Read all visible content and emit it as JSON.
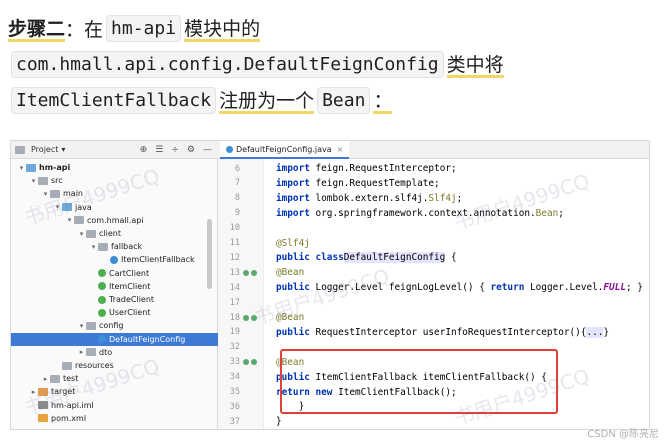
{
  "heading": {
    "line1": {
      "bold": "步骤二",
      "t1": "：在",
      "code1": "hm-api",
      "t2": "模块中的"
    },
    "line2": {
      "code1": "com.hmall.api.config.DefaultFeignConfig",
      "t1": "类中将"
    },
    "line3": {
      "code1": "ItemClientFallback",
      "t1": "注册为一个",
      "code2": "Bean",
      "t2": "："
    }
  },
  "ide": {
    "project_label": "Project",
    "toolbar_icons": [
      "⊕",
      "☰",
      "÷",
      "⚙",
      "—"
    ],
    "tab_label": "DefaultFeignConfig.java",
    "tree": [
      {
        "label": "hm-api",
        "level": 0,
        "arrow": "▾",
        "icon": "folder-blue",
        "bold": true
      },
      {
        "label": "src",
        "level": 1,
        "arrow": "▾",
        "icon": "folder"
      },
      {
        "label": "main",
        "level": 2,
        "arrow": "▾",
        "icon": "folder"
      },
      {
        "label": "java",
        "level": 3,
        "arrow": "▾",
        "icon": "folder-blue"
      },
      {
        "label": "com.hmall.api",
        "level": 4,
        "arrow": "▾",
        "icon": "folder"
      },
      {
        "label": "client",
        "level": 5,
        "arrow": "▾",
        "icon": "folder"
      },
      {
        "label": "fallback",
        "level": 6,
        "arrow": "▾",
        "icon": "folder"
      },
      {
        "label": "ItemClientFallback",
        "level": 7,
        "arrow": "",
        "icon": "cls"
      },
      {
        "label": "CartClient",
        "level": 6,
        "arrow": "",
        "icon": "cls intf"
      },
      {
        "label": "ItemClient",
        "level": 6,
        "arrow": "",
        "icon": "cls intf"
      },
      {
        "label": "TradeClient",
        "level": 6,
        "arrow": "",
        "icon": "cls intf"
      },
      {
        "label": "UserClient",
        "level": 6,
        "arrow": "",
        "icon": "cls intf"
      },
      {
        "label": "config",
        "level": 5,
        "arrow": "▾",
        "icon": "folder"
      },
      {
        "label": "DefaultFeignConfig",
        "level": 6,
        "arrow": "",
        "icon": "cls",
        "selected": true
      },
      {
        "label": "dto",
        "level": 5,
        "arrow": "▸",
        "icon": "folder"
      },
      {
        "label": "resources",
        "level": 3,
        "arrow": "",
        "icon": "folder"
      },
      {
        "label": "test",
        "level": 2,
        "arrow": "▸",
        "icon": "folder"
      },
      {
        "label": "target",
        "level": 1,
        "arrow": "▸",
        "icon": "folder-orange"
      },
      {
        "label": "hm-api.iml",
        "level": 1,
        "arrow": "",
        "icon": "file-iml"
      },
      {
        "label": "pom.xml",
        "level": 1,
        "arrow": "",
        "icon": "file-xml"
      }
    ],
    "code_lines": [
      {
        "n": "6",
        "html": "<span class='kw'>import</span> feign.RequestInterceptor;"
      },
      {
        "n": "7",
        "html": "<span class='kw'>import</span> feign.RequestTemplate;"
      },
      {
        "n": "8",
        "html": "<span class='kw'>import</span> lombok.extern.slf4j.<span class='ann'>Slf4j</span>;"
      },
      {
        "n": "9",
        "html": "<span class='kw'>import</span> org.springframework.context.annotation.<span class='ann'>Bean</span>;"
      },
      {
        "n": "10",
        "html": ""
      },
      {
        "n": "11",
        "html": "<span class='ann'>@Slf4j</span>"
      },
      {
        "n": "12",
        "html": "<span class='kw'>public class</span> <span class='hl-cls'>DefaultFeignConfig</span> {"
      },
      {
        "n": "13",
        "html": "    <span class='ann'>@Bean</span>",
        "mark": true
      },
      {
        "n": "14",
        "html": "    <span class='kw'>public</span> Logger.Level feignLogLevel() { <span class='kw'>return</span> Logger.Level.<span class='fld'>FULL</span>; }"
      },
      {
        "n": "17",
        "html": ""
      },
      {
        "n": "18",
        "html": "    <span class='ann'>@Bean</span>",
        "mark": true
      },
      {
        "n": "19",
        "html": "    <span class='kw'>public</span> RequestInterceptor userInfoRequestInterceptor(){<span class='fold'>...</span>}"
      },
      {
        "n": "32",
        "html": ""
      },
      {
        "n": "33",
        "html": "    <span class='ann'>@Bean</span>",
        "mark": true
      },
      {
        "n": "34",
        "html": "    <span class='kw'>public</span> ItemClientFallback itemClientFallback() {"
      },
      {
        "n": "35",
        "html": "        <span class='kw'>return new</span> ItemClientFallback();"
      },
      {
        "n": "36",
        "html": "    }"
      },
      {
        "n": "37",
        "html": "}"
      }
    ],
    "watermarks": [
      "书用户4999CQ",
      "书用户4999CQ",
      "书用户4999CQ",
      "书用户4999CQ",
      "书用户4999CQ"
    ]
  },
  "footer": "CSDN @陈亮尼"
}
